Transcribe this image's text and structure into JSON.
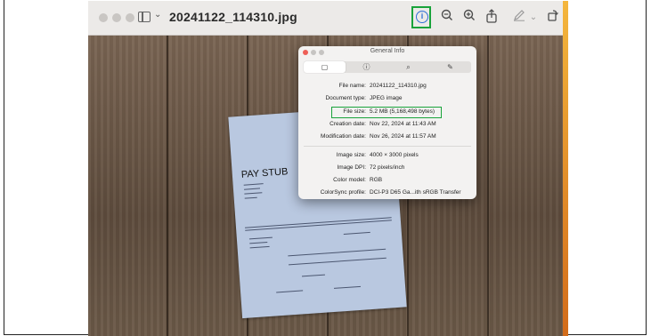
{
  "window": {
    "title": "20241122_114310.jpg"
  },
  "toolbar": {
    "icons": [
      "info-icon",
      "zoom-out-icon",
      "zoom-in-icon",
      "share-icon",
      "markup-pen-icon",
      "chevron-down-icon",
      "rotate-icon",
      "markup-circle-icon",
      "signature-box-icon",
      "search-icon"
    ],
    "info_glyph": "i"
  },
  "document": {
    "heading": "PAY STUB"
  },
  "info_panel": {
    "title": "General Info",
    "tabs": [
      {
        "icon": "document-icon",
        "glyph": "▢"
      },
      {
        "icon": "info-icon",
        "glyph": "ⓘ"
      },
      {
        "icon": "search-icon",
        "glyph": "⌕"
      },
      {
        "icon": "pen-icon",
        "glyph": "✎"
      }
    ],
    "rows": [
      {
        "label": "File name:",
        "value": "20241122_114310.jpg"
      },
      {
        "label": "Document type:",
        "value": "JPEG image"
      },
      {
        "label": "File size:",
        "value": "5.2 MB (5,168,498 bytes)"
      },
      {
        "label": "Creation date:",
        "value": "Nov 22, 2024 at 11:43 AM"
      },
      {
        "label": "Modification date:",
        "value": "Nov 26, 2024 at 11:57 AM"
      },
      {
        "label": "Image size:",
        "value": "4000 × 3000 pixels"
      },
      {
        "label": "Image DPI:",
        "value": "72 pixels/inch"
      },
      {
        "label": "Color model:",
        "value": "RGB"
      },
      {
        "label": "ColorSync profile:",
        "value": "DCI-P3 D65 Ga...ith sRGB Transfer"
      }
    ]
  },
  "colors": {
    "highlight": "#19a33a",
    "accent": "#2f6fd6"
  }
}
